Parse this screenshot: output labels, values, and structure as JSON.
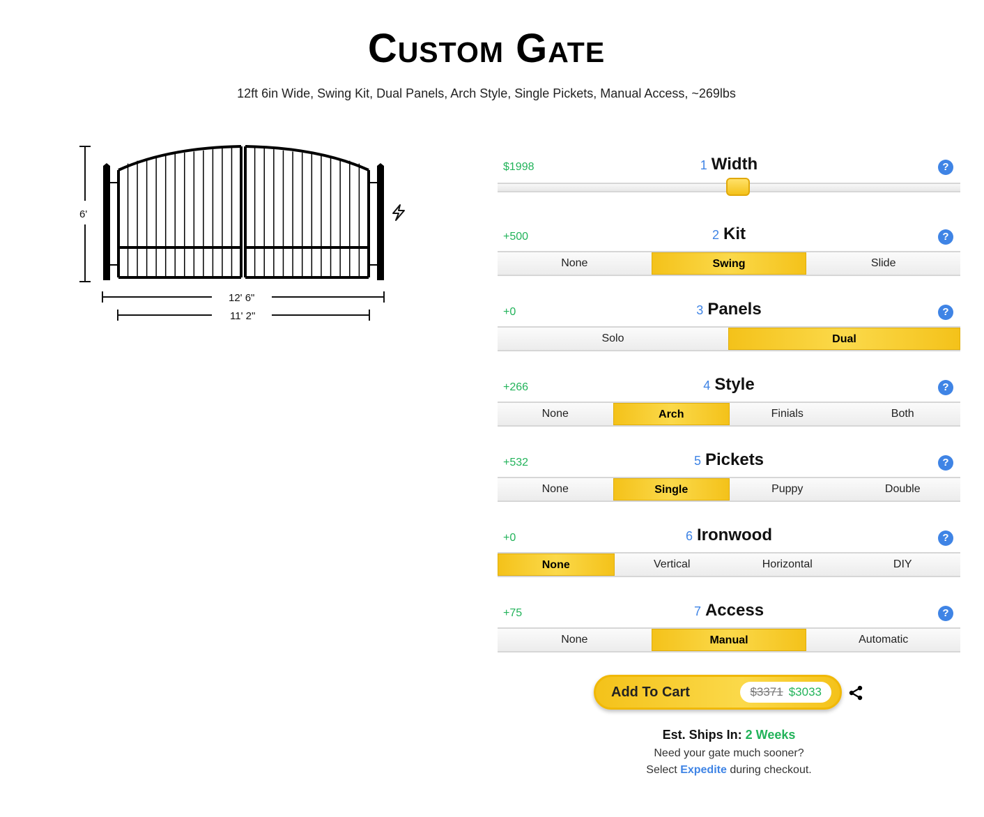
{
  "header": {
    "title": "Custom Gate",
    "summary": "12ft 6in Wide, Swing Kit, Dual Panels, Arch Style, Single Pickets, Manual Access, ~269lbs"
  },
  "drawing": {
    "height_label": "6'",
    "outer_width_label": "12' 6\"",
    "inner_width_label": "11' 2\"",
    "lightning_icon": "lightning-icon"
  },
  "options": [
    {
      "num": "1",
      "title": "Width",
      "price": "$1998",
      "type": "slider",
      "slider_fraction": 0.52
    },
    {
      "num": "2",
      "title": "Kit",
      "price": "+500",
      "choices": [
        "None",
        "Swing",
        "Slide"
      ],
      "selected": 1
    },
    {
      "num": "3",
      "title": "Panels",
      "price": "+0",
      "choices": [
        "Solo",
        "Dual"
      ],
      "selected": 1
    },
    {
      "num": "4",
      "title": "Style",
      "price": "+266",
      "choices": [
        "None",
        "Arch",
        "Finials",
        "Both"
      ],
      "selected": 1
    },
    {
      "num": "5",
      "title": "Pickets",
      "price": "+532",
      "choices": [
        "None",
        "Single",
        "Puppy",
        "Double"
      ],
      "selected": 1
    },
    {
      "num": "6",
      "title": "Ironwood",
      "price": "+0",
      "choices": [
        "None",
        "Vertical",
        "Horizontal",
        "DIY"
      ],
      "selected": 0
    },
    {
      "num": "7",
      "title": "Access",
      "price": "+75",
      "choices": [
        "None",
        "Manual",
        "Automatic"
      ],
      "selected": 1
    }
  ],
  "help_label": "?",
  "cart": {
    "label": "Add To Cart",
    "old_price": "$3371",
    "new_price": "$3033",
    "share_icon": "share-icon"
  },
  "shipping": {
    "label": "Est. Ships In:",
    "value": "2 Weeks",
    "note_line1": "Need your gate much sooner?",
    "note_line2_prefix": "Select",
    "note_line2_link": "Expedite",
    "note_line2_suffix": "during checkout."
  },
  "colors": {
    "accent_yellow": "#f4c21a",
    "price_green": "#22b35a",
    "link_blue": "#3f84e5"
  }
}
